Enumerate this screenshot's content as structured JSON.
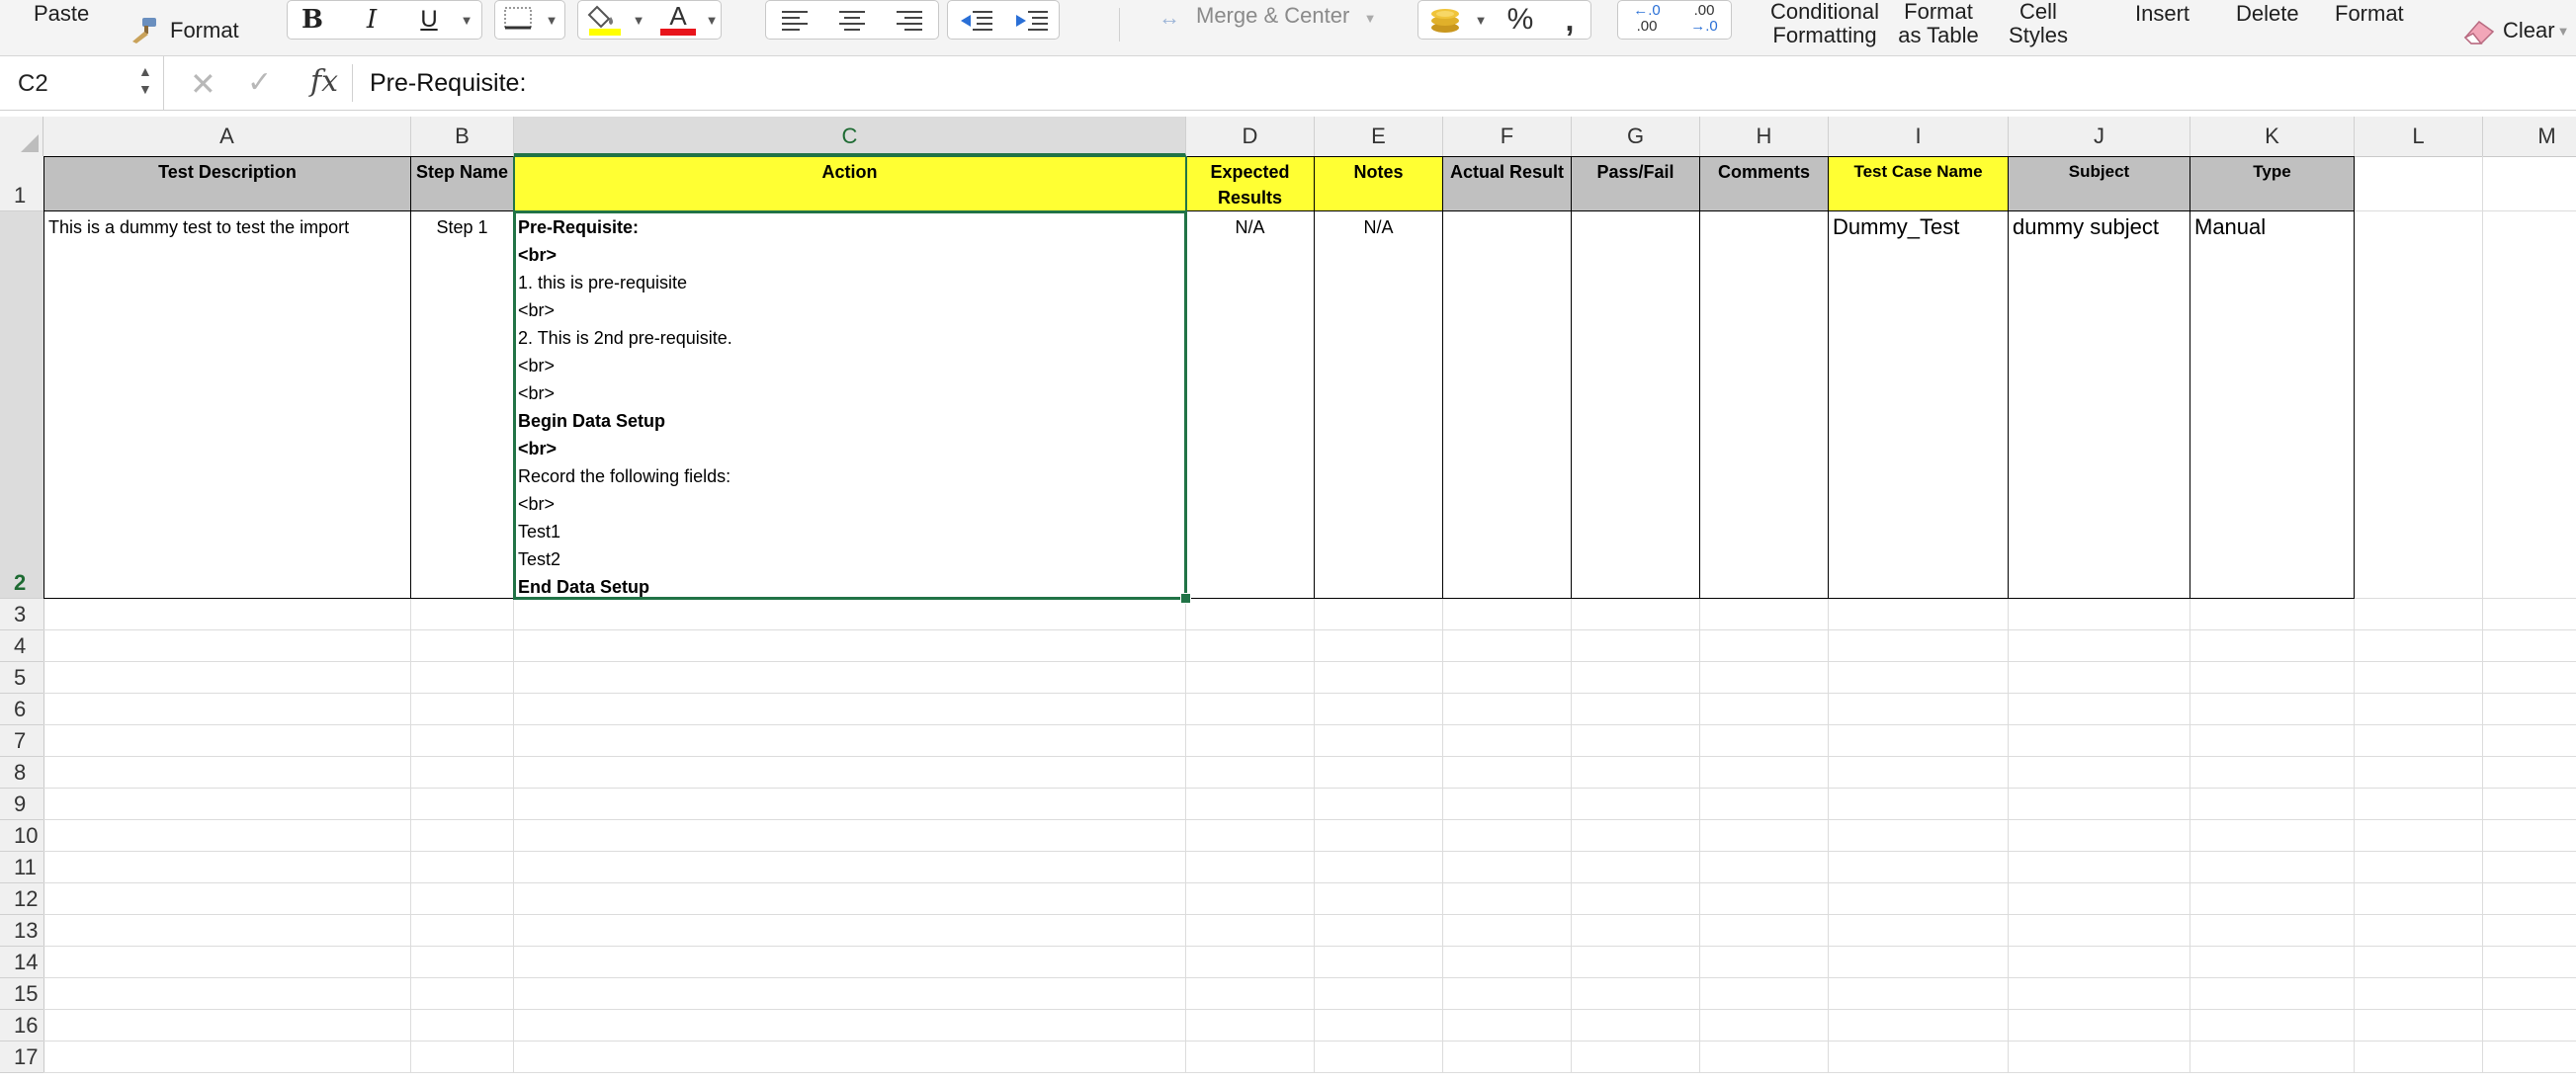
{
  "ribbon": {
    "paste_label": "Paste",
    "format_painter_label": "Format",
    "bold": "B",
    "italic": "I",
    "underline": "U",
    "font_color_letter": "A",
    "fill_color": "#ffff00",
    "font_color": "#e8141b",
    "merge_center_label": "Merge & Center",
    "percent": "%",
    "comma": ",",
    "increase_decimal_top": "←.0",
    "increase_decimal_bottom": ".00",
    "decrease_decimal_top": ".00",
    "decrease_decimal_bottom": "→.0",
    "conditional_formatting_line1": "Conditional",
    "conditional_formatting_line2": "Formatting",
    "format_as_table_line1": "Format",
    "format_as_table_line2": "as Table",
    "cell_styles_line1": "Cell",
    "cell_styles_line2": "Styles",
    "insert_label": "Insert",
    "delete_label": "Delete",
    "format_label": "Format",
    "clear_label": "Clear"
  },
  "formula_bar": {
    "name_box": "C2",
    "value": "Pre-Requisite:"
  },
  "columns": [
    "A",
    "B",
    "C",
    "D",
    "E",
    "F",
    "G",
    "H",
    "I",
    "J",
    "K",
    "L",
    "M"
  ],
  "rows": [
    "1",
    "2",
    "3",
    "4",
    "5",
    "6",
    "7",
    "8",
    "9",
    "10",
    "11",
    "12",
    "13",
    "14",
    "15",
    "16",
    "17"
  ],
  "selected_cell": "C2",
  "headers": {
    "A": "Test Description",
    "B": "Step Name",
    "C": "Action",
    "D": "Expected Results",
    "E": "Notes",
    "F": "Actual Result",
    "G": "Pass/Fail",
    "H": "Comments",
    "I": "Test Case Name",
    "J": "Subject",
    "K": "Type"
  },
  "row2": {
    "A": "This is a dummy test to test the import",
    "B": "Step 1",
    "C_lines": [
      {
        "text": "Pre-Requisite:",
        "bold": true
      },
      {
        "text": "<br>",
        "bold": true
      },
      {
        "text": "1. this is pre-requisite",
        "bold": false
      },
      {
        "text": "<br>",
        "bold": false
      },
      {
        "text": "2. This is 2nd pre-requisite.",
        "bold": false
      },
      {
        "text": "<br>",
        "bold": false
      },
      {
        "text": "<br>",
        "bold": false
      },
      {
        "text": "Begin Data Setup",
        "bold": true
      },
      {
        "text": "<br>",
        "bold": true
      },
      {
        "text": "Record the following fields:",
        "bold": false
      },
      {
        "text": "<br>",
        "bold": false
      },
      {
        "text": "Test1",
        "bold": false
      },
      {
        "text": "Test2",
        "bold": false
      },
      {
        "text": "End Data Setup",
        "bold": true
      }
    ],
    "D": "N/A",
    "E": "N/A",
    "I": "Dummy_Test",
    "J": "dummy subject",
    "K": "Manual"
  },
  "colors": {
    "header_gray": "#c0c0c0",
    "header_yellow": "#ffff33",
    "selection_green": "#217346"
  }
}
